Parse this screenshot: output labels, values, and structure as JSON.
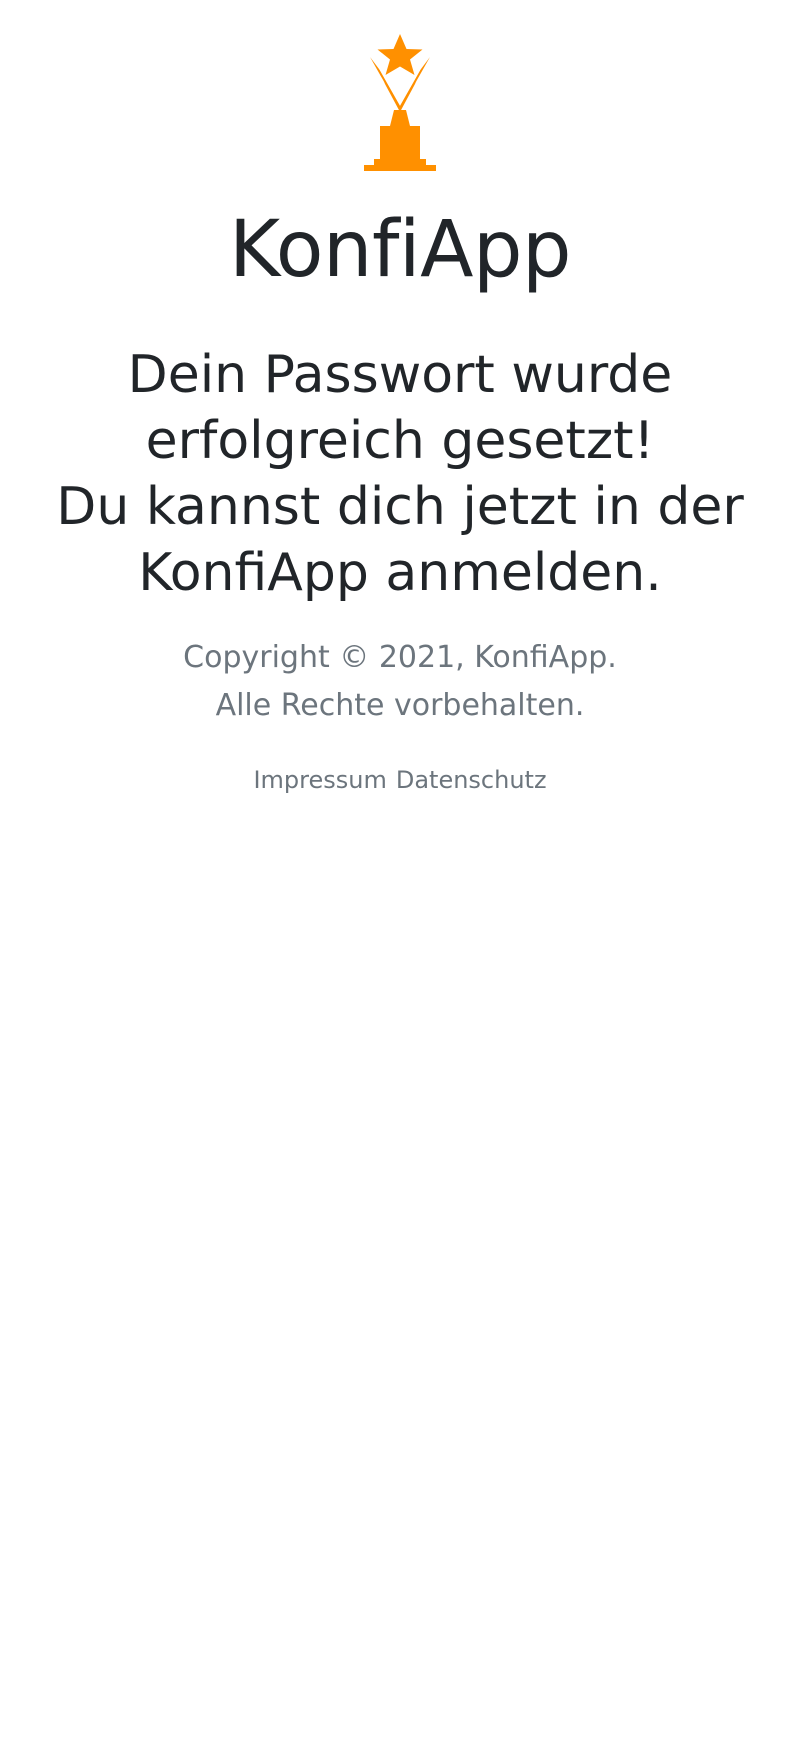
{
  "brand": {
    "logo_icon": "trophy-star-icon",
    "logo_color": "#FF9000",
    "app_name": "KonfiApp"
  },
  "message": {
    "line1": "Dein Passwort wurde",
    "line2": "erfolgreich gesetzt!",
    "line3": "Du kannst dich jetzt in der",
    "line4": "KonfiApp anmelden."
  },
  "footer": {
    "copyright_line1": "Copyright © 2021, KonfiApp.",
    "copyright_line2": "Alle Rechte vorbehalten.",
    "links": {
      "impressum": "Impressum",
      "datenschutz": "Datenschutz"
    }
  },
  "colors": {
    "text_primary": "#212529",
    "text_muted": "#6c757d",
    "background": "#ffffff"
  }
}
